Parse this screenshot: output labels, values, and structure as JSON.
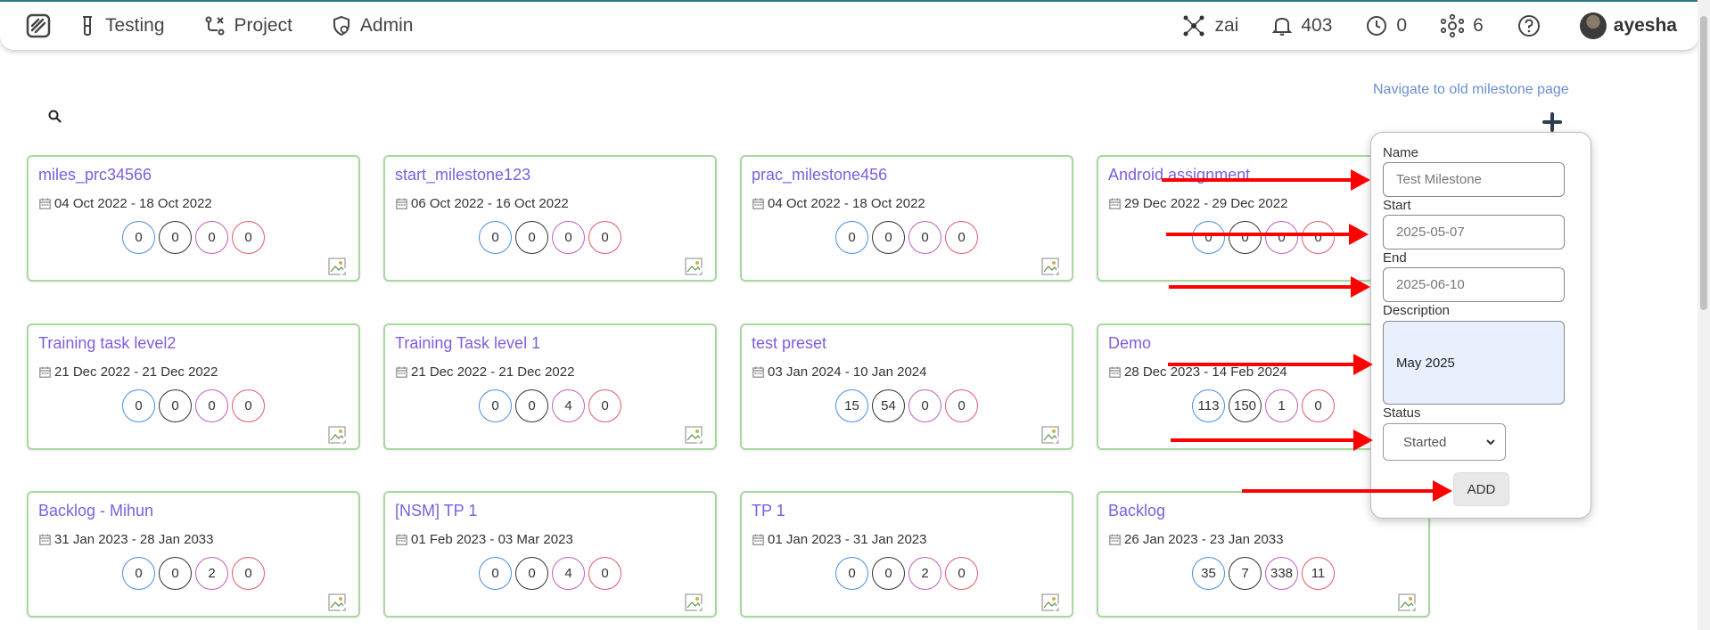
{
  "nav": {
    "items": [
      {
        "label": "Testing"
      },
      {
        "label": "Project"
      },
      {
        "label": "Admin"
      }
    ],
    "right": {
      "workspace": "zai",
      "notifications": "403",
      "timers": "0",
      "integrations": "6",
      "user": "ayesha"
    }
  },
  "page": {
    "old_link": "Navigate to old milestone page"
  },
  "cards": [
    {
      "title": "miles_prc34566",
      "dates": "04 Oct 2022 - 18 Oct 2022",
      "counts": [
        "0",
        "0",
        "0",
        "0"
      ]
    },
    {
      "title": "start_milestone123",
      "dates": "06 Oct 2022 - 16 Oct 2022",
      "counts": [
        "0",
        "0",
        "0",
        "0"
      ]
    },
    {
      "title": "prac_milestone456",
      "dates": "04 Oct 2022 - 18 Oct 2022",
      "counts": [
        "0",
        "0",
        "0",
        "0"
      ]
    },
    {
      "title": "Android assignment",
      "dates": "29 Dec 2022 - 29 Dec 2022",
      "counts": [
        "0",
        "0",
        "0",
        "0"
      ]
    },
    {
      "title": "Training task level2",
      "dates": "21 Dec 2022 - 21 Dec 2022",
      "counts": [
        "0",
        "0",
        "0",
        "0"
      ]
    },
    {
      "title": "Training Task level 1",
      "dates": "21 Dec 2022 - 21 Dec 2022",
      "counts": [
        "0",
        "0",
        "4",
        "0"
      ]
    },
    {
      "title": "test preset",
      "dates": "03 Jan 2024 - 10 Jan 2024",
      "counts": [
        "15",
        "54",
        "0",
        "0"
      ]
    },
    {
      "title": "Demo",
      "dates": "28 Dec 2023 - 14 Feb 2024",
      "counts": [
        "113",
        "150",
        "1",
        "0"
      ]
    },
    {
      "title": "Backlog - Mihun",
      "dates": "31 Jan 2023 - 28 Jan 2033",
      "counts": [
        "0",
        "0",
        "2",
        "0"
      ]
    },
    {
      "title": "[NSM] TP 1",
      "dates": "01 Feb 2023 - 03 Mar 2023",
      "counts": [
        "0",
        "0",
        "4",
        "0"
      ]
    },
    {
      "title": "TP 1",
      "dates": "01 Jan 2023 - 31 Jan 2023",
      "counts": [
        "0",
        "0",
        "2",
        "0"
      ]
    },
    {
      "title": "Backlog",
      "dates": "26 Jan 2023 - 23 Jan 2033",
      "counts": [
        "35",
        "7",
        "338",
        "11"
      ]
    }
  ],
  "form": {
    "name_label": "Name",
    "name_placeholder": "Test Milestone",
    "start_label": "Start",
    "start_value": "2025-05-07",
    "end_label": "End",
    "end_value": "2025-06-10",
    "description_label": "Description",
    "description_value": "May 2025",
    "status_label": "Status",
    "status_value": "Started",
    "submit_label": "ADD"
  },
  "colors": {
    "card_border": "#a8d8a0",
    "title": "#7b5fe0",
    "link": "#6a8fd0",
    "annotation_arrow": "#ff0000"
  }
}
